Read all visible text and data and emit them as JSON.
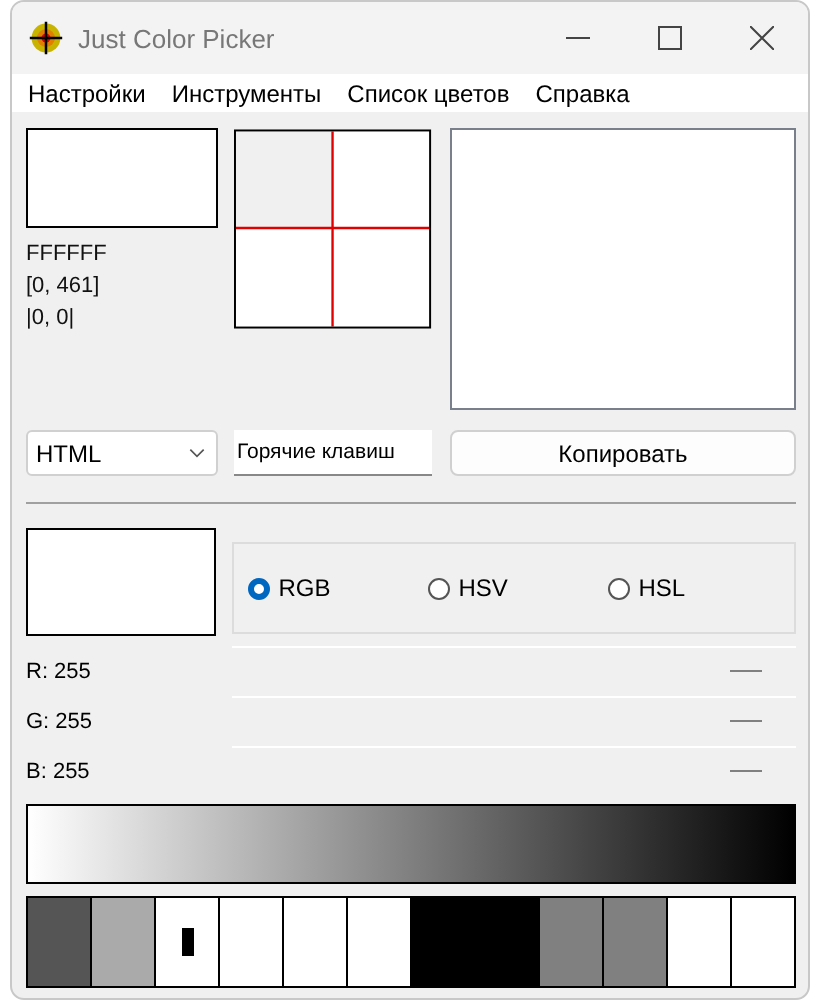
{
  "window": {
    "title": "Just Color Picker"
  },
  "menu": [
    "Настройки",
    "Инструменты",
    "Список цветов",
    "Справка"
  ],
  "current": {
    "hex": "FFFFFF",
    "position": "[0, 461]",
    "offset": "|0, 0|"
  },
  "format_dropdown": {
    "value": "HTML"
  },
  "hotkeys_field": {
    "value": "Горячие клавиш"
  },
  "copy_button": "Копировать",
  "modes": [
    {
      "label": "RGB",
      "selected": true
    },
    {
      "label": "HSV",
      "selected": false
    },
    {
      "label": "HSL",
      "selected": false
    }
  ],
  "channels": [
    {
      "label": "R: 255"
    },
    {
      "label": "G: 255"
    },
    {
      "label": "B: 255"
    }
  ],
  "palette": [
    {
      "color": "#555555"
    },
    {
      "color": "#aaaaaa"
    },
    {
      "color": "#ffffff",
      "current": true
    },
    {
      "color": "#ffffff"
    },
    {
      "color": "#ffffff"
    },
    {
      "color": "#ffffff"
    },
    {
      "color": "#000000",
      "kind": "double"
    },
    {
      "color": "#808080"
    },
    {
      "color": "#808080"
    },
    {
      "color": "#ffffff"
    },
    {
      "color": "#ffffff"
    }
  ]
}
